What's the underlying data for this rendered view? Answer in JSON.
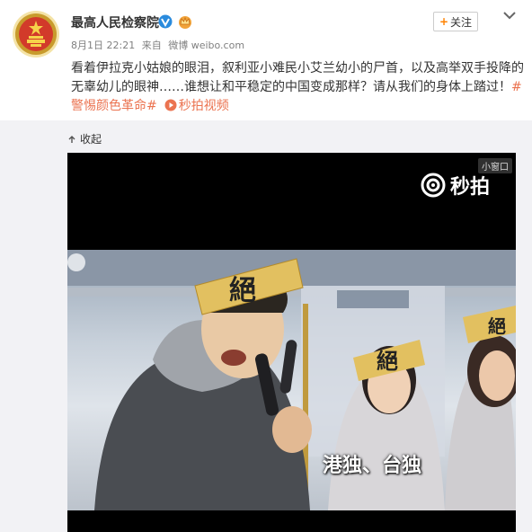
{
  "author": {
    "name": "最高人民检察院",
    "avatar_icon": "procuratorate-emblem-icon",
    "verified_icon": "verified-blue-v-icon",
    "badge_icon": "crown-badge-icon"
  },
  "meta": {
    "date": "8月1日 22:21",
    "source_prefix": "来自",
    "source": "微博 weibo.com"
  },
  "follow_button": {
    "plus": "+",
    "label": "关注"
  },
  "more_icon": "chevron-down-icon",
  "post": {
    "text": "看着伊拉克小姑娘的眼泪，叙利亚小难民小艾兰幼小的尸首，以及高举双手投降的无辜幼儿的眼神……谁想让和平稳定的中国变成那样？请从我们的身体上踏过！",
    "hashtag": "#警惕颜色革命#",
    "video_link": "秒拍视频"
  },
  "collapse": {
    "label": "收起"
  },
  "video": {
    "mini_label": "小窗口",
    "watermark": "秒拍",
    "subtitle": "港独、台独",
    "headband_text": "絕"
  },
  "colors": {
    "link": "#eb7350",
    "verified": "#2a8bdd",
    "follow_plus": "#ff8200"
  }
}
